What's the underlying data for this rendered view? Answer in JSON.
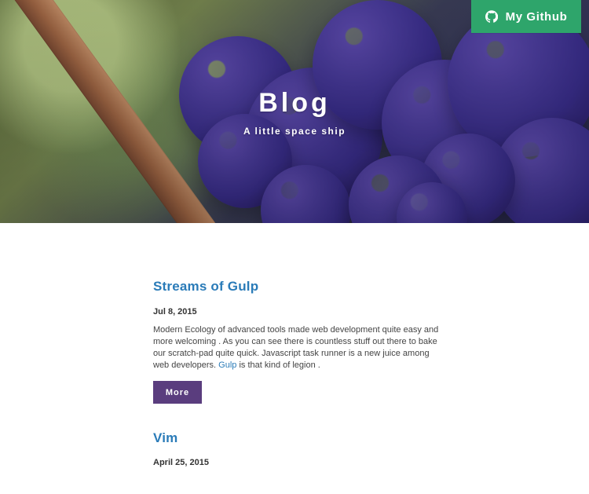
{
  "hero": {
    "title": "Blog",
    "subtitle": "A little space ship"
  },
  "github": {
    "label": "My Github",
    "icon": "github-icon",
    "color": "#2ea56b"
  },
  "posts": [
    {
      "title": "Streams of Gulp",
      "date": "Jul 8, 2015",
      "excerpt_before_link": "Modern Ecology of advanced tools made web development quite easy and more welcoming . As you can see there is countless stuff out there to bake our scratch-pad quite quick. Javascript task runner is a new juice among web developers.",
      "link_text": "Gulp",
      "excerpt_after_link": "is that kind of legion .",
      "more_label": "More"
    },
    {
      "title": "Vim",
      "date": "April 25, 2015"
    }
  ],
  "colors": {
    "link": "#2a7bb8",
    "more_button": "#5a3d7e"
  }
}
